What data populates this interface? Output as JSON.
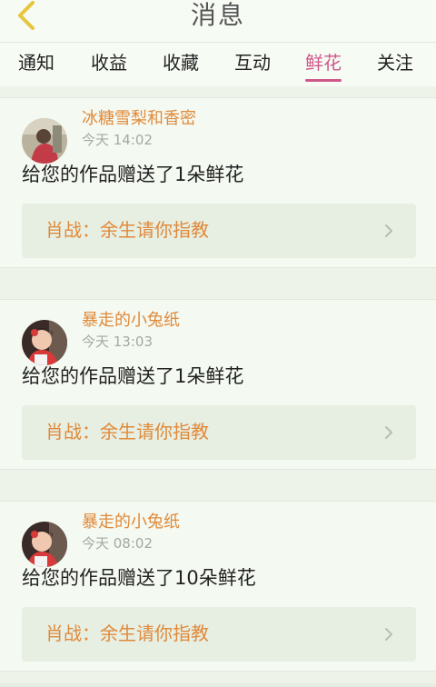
{
  "header": {
    "title": "消息",
    "back_icon": "chevron-left-icon"
  },
  "tabs": [
    {
      "label": "通知",
      "active": false
    },
    {
      "label": "收益",
      "active": false
    },
    {
      "label": "收藏",
      "active": false
    },
    {
      "label": "互动",
      "active": false
    },
    {
      "label": "鲜花",
      "active": true
    },
    {
      "label": "关注",
      "active": false
    }
  ],
  "notifications": [
    {
      "user": "冰糖雪梨和香密",
      "time": "今天 14:02",
      "message": "给您的作品赠送了1朵鲜花",
      "work_ref": "肖战：余生请你指教"
    },
    {
      "user": "暴走的小兔纸",
      "time": "今天 13:03",
      "message": "给您的作品赠送了1朵鲜花",
      "work_ref": "肖战：余生请你指教"
    },
    {
      "user": "暴走的小兔纸",
      "time": "今天 08:02",
      "message": "给您的作品赠送了10朵鲜花",
      "work_ref": "肖战：余生请你指教"
    }
  ],
  "colors": {
    "accent": "#d0578b",
    "username": "#e08a3a",
    "back_icon": "#e7c63d"
  }
}
